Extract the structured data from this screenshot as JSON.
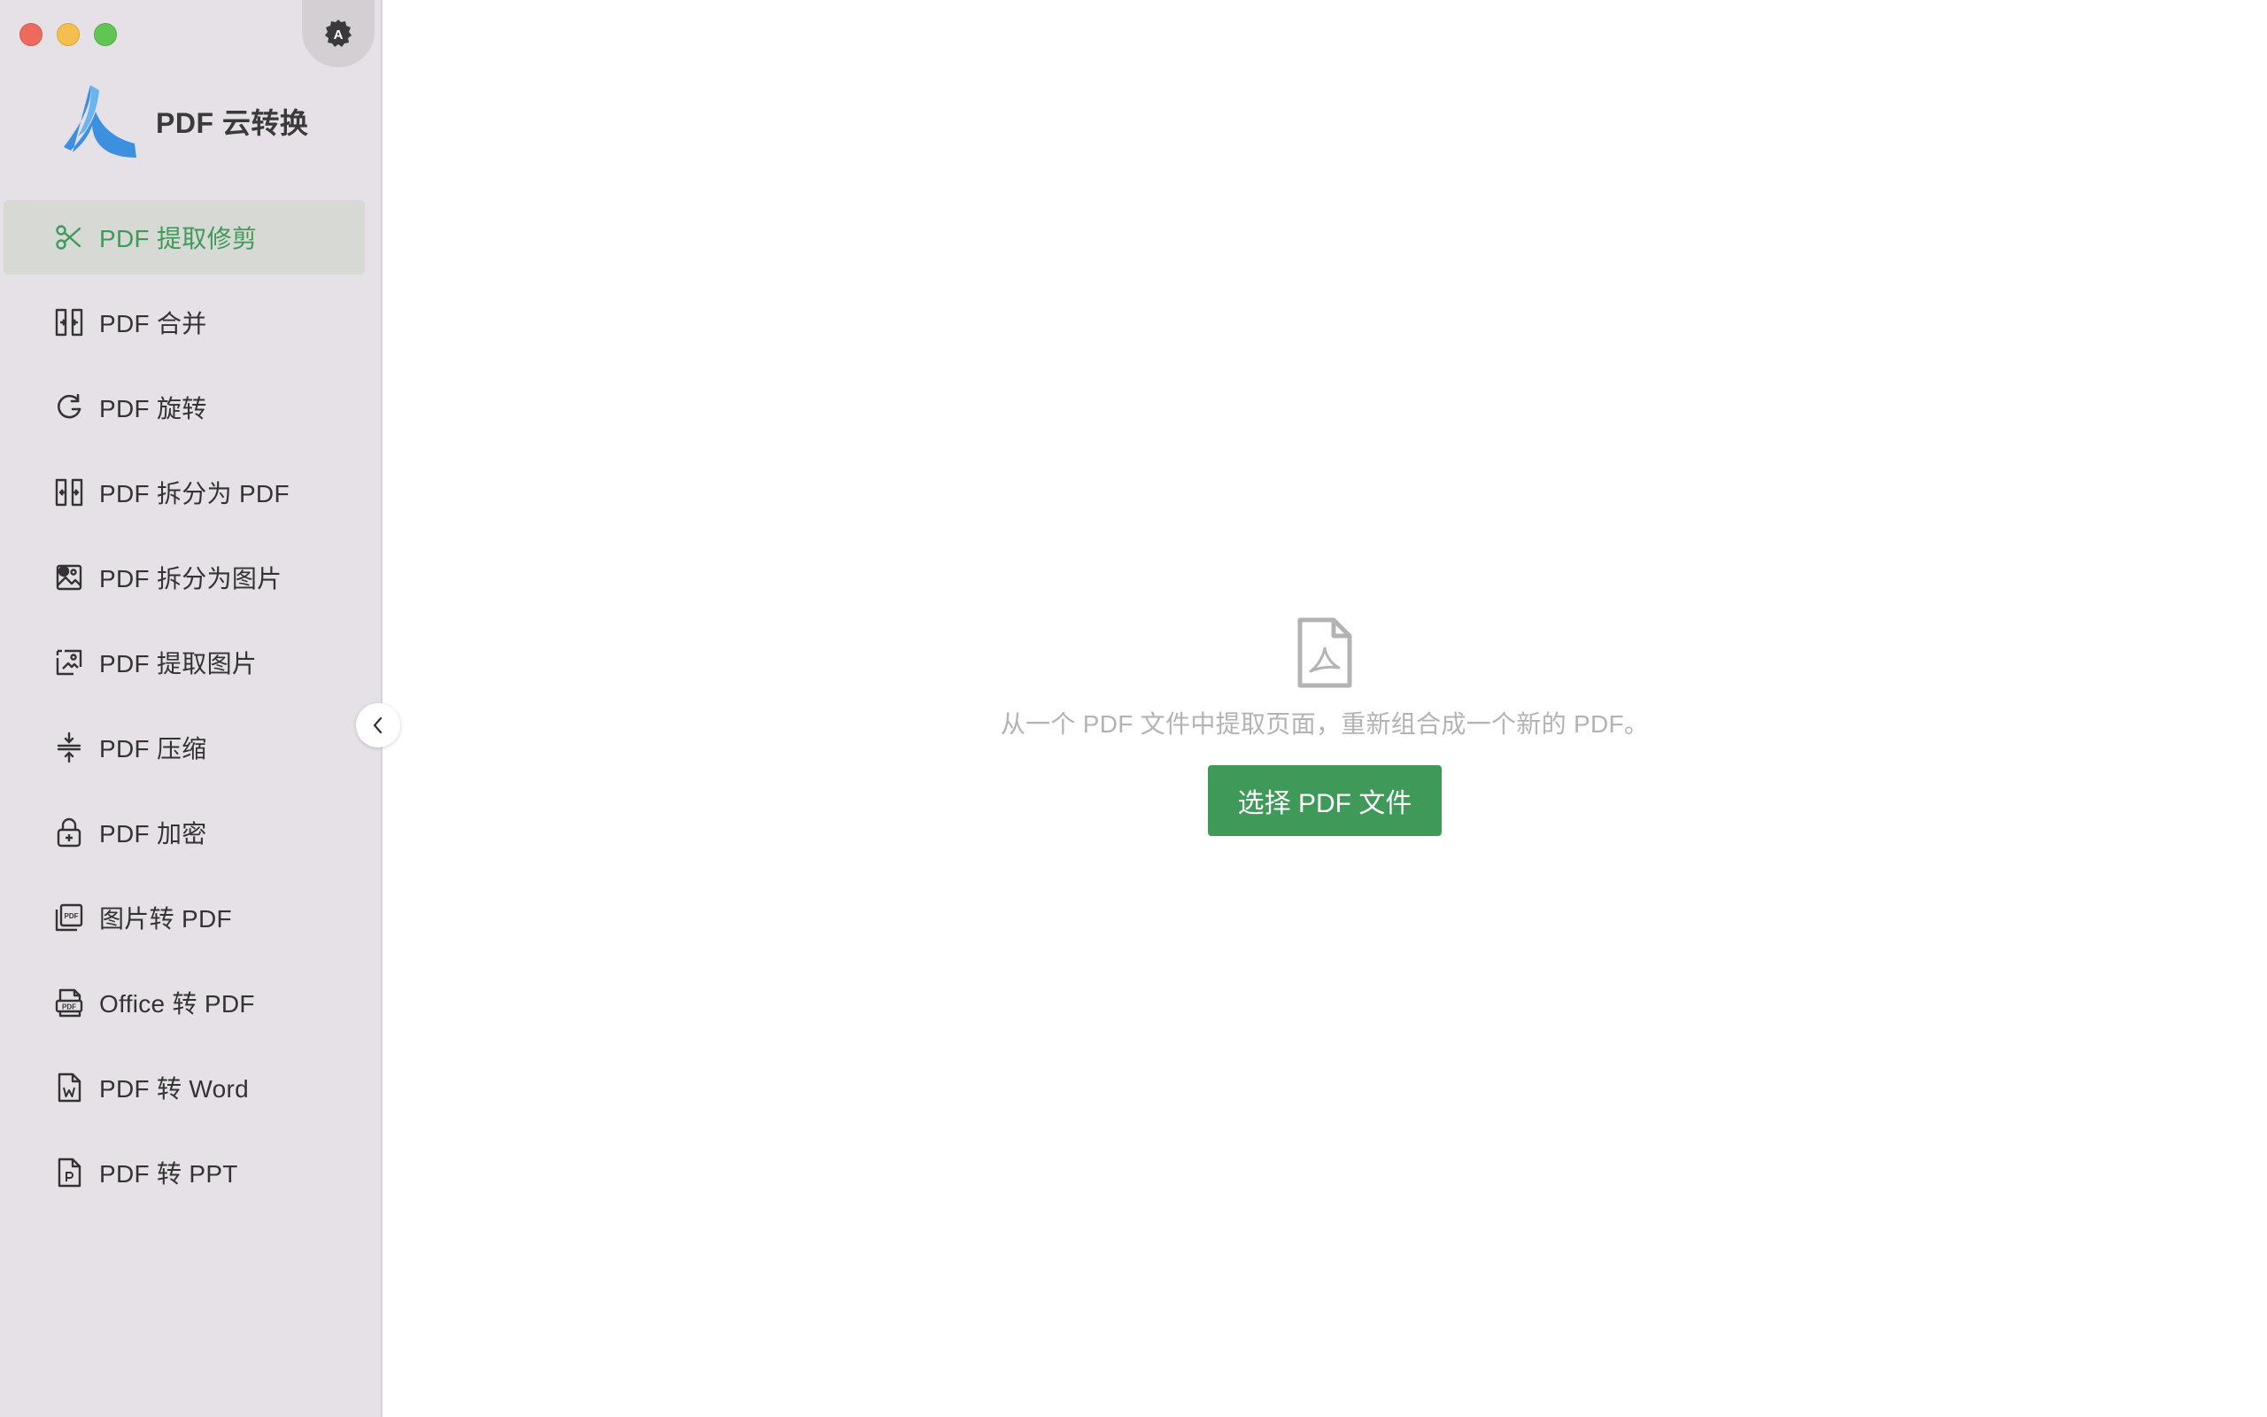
{
  "window": {
    "traffic_lights": {
      "close": "#ed6a5e",
      "minimize": "#f5bf4f",
      "zoom": "#61c554"
    }
  },
  "sidebar": {
    "brand_title": "PDF 云转换",
    "appearance_icon_letter": "A",
    "items": [
      {
        "label": "PDF 提取修剪",
        "icon": "scissors-icon",
        "active": true
      },
      {
        "label": "PDF 合并",
        "icon": "merge-icon"
      },
      {
        "label": "PDF 旋转",
        "icon": "rotate-icon"
      },
      {
        "label": "PDF 拆分为 PDF",
        "icon": "split-icon"
      },
      {
        "label": "PDF 拆分为图片",
        "icon": "split-image-icon"
      },
      {
        "label": "PDF 提取图片",
        "icon": "extract-image-icon"
      },
      {
        "label": "PDF 压缩",
        "icon": "compress-icon"
      },
      {
        "label": "PDF 加密",
        "icon": "lock-icon"
      },
      {
        "label": "图片转 PDF",
        "icon": "image-to-pdf-icon"
      },
      {
        "label": "Office 转 PDF",
        "icon": "office-to-pdf-icon"
      },
      {
        "label": "PDF 转 Word",
        "icon": "word-file-icon"
      },
      {
        "label": "PDF 转 PPT",
        "icon": "ppt-file-icon"
      }
    ]
  },
  "main": {
    "hint": "从一个 PDF 文件中提取页面，重新组合成一个新的 PDF。",
    "select_button": "选择 PDF 文件"
  },
  "colors": {
    "accent": "#3f9a5a",
    "sidebar_bg": "#e6e1e6",
    "active_item_bg": "#d6d9d4",
    "hint_text": "#b3b3b3",
    "logo_blue": "#3d8fe0"
  }
}
